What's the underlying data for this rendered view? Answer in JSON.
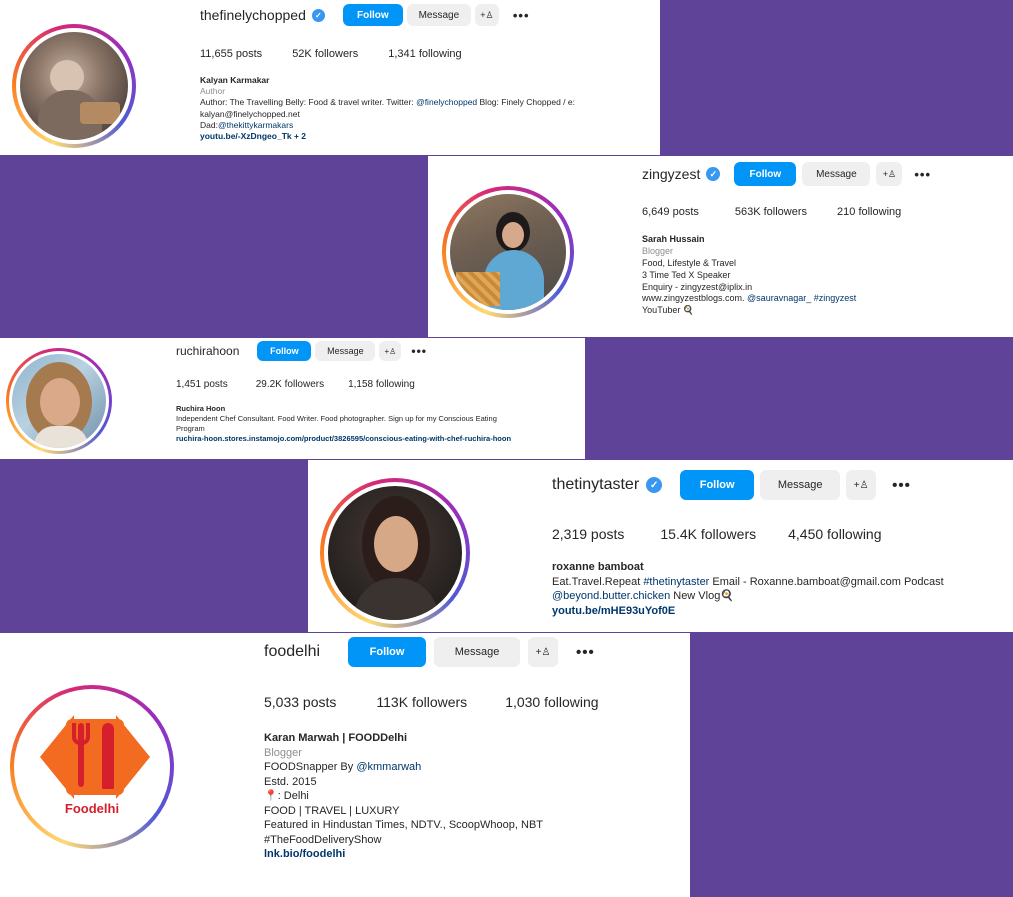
{
  "profiles": [
    {
      "username": "thefinelychopped",
      "follow": "Follow",
      "message": "Message",
      "posts": "11,655 posts",
      "followers": "52K followers",
      "following": "1,341 following",
      "name": "Kalyan Karmakar",
      "category": "Author",
      "bio1": "Author: The Travelling Belly: Food & travel writer. Twitter: ",
      "bio1_mention": "@finelychopped",
      "bio1_end": " Blog: Finely Chopped / e:",
      "bio2": "kalyan@finelychopped.net",
      "bio3": "Dad:",
      "bio3_mention": "@thekittykarmakars",
      "link": "youtu.be/-XzDngeo_Tk + 2"
    },
    {
      "username": "zingyzest",
      "follow": "Follow",
      "message": "Message",
      "posts": "6,649 posts",
      "followers": "563K followers",
      "following": "210 following",
      "name": "Sarah Hussain",
      "category": "Blogger",
      "bio1": "Food, Lifestyle & Travel",
      "bio2": "3 Time Ted X Speaker",
      "bio3": "Enquiry - zingyzest@iplix.in",
      "bio4": "www.zingyzestblogs.com. ",
      "bio4_mention": "@sauravnagar_ #zingyzest",
      "bio5": "YouTuber 🍳"
    },
    {
      "username": "ruchirahoon",
      "follow": "Follow",
      "message": "Message",
      "posts": "1,451 posts",
      "followers": "29.2K followers",
      "following": "1,158 following",
      "name": "Ruchira Hoon",
      "bio1": "Independent Chef Consultant. Food Writer. Food photographer. Sign up for my Conscious Eating",
      "bio2": "Program",
      "link": "ruchira-hoon.stores.instamojo.com/product/3826595/conscious-eating-with-chef-ruchira-hoon"
    },
    {
      "username": "thetinytaster",
      "follow": "Follow",
      "message": "Message",
      "posts": "2,319 posts",
      "followers": "15.4K followers",
      "following": "4,450 following",
      "name": "roxanne bamboat",
      "bio1": "Eat.Travel.Repeat ",
      "bio1_mention": "#thetinytaster",
      "bio1_end": " Email - Roxanne.bamboat@gmail.com Podcast",
      "bio2_mention": "@beyond.butter.chicken",
      "bio2_end": " New Vlog🍳",
      "link": "youtu.be/mHE93uYof0E"
    },
    {
      "username": "foodelhi",
      "follow": "Follow",
      "message": "Message",
      "posts": "5,033 posts",
      "followers": "113K followers",
      "following": "1,030 following",
      "name": "Karan Marwah | FOODDelhi",
      "category": "Blogger",
      "bio1": "FOODSnapper By ",
      "bio1_mention": "@kmmarwah",
      "bio2": "Estd. 2015",
      "bio3": "📍: Delhi",
      "bio4": "FOOD | TRAVEL | LUXURY",
      "bio5": "Featured in Hindustan Times, NDTV., ScoopWhoop, NBT",
      "bio6": "#TheFoodDeliveryShow",
      "link": "lnk.bio/foodelhi",
      "logo_text": "Foodelhi"
    }
  ],
  "icons": {
    "verified": "verified-badge-icon",
    "add_person": "add-person-icon",
    "more": "more-options-icon"
  },
  "colors": {
    "background": "#5e4398",
    "follow_button": "#0095f6",
    "link": "#00376b"
  }
}
